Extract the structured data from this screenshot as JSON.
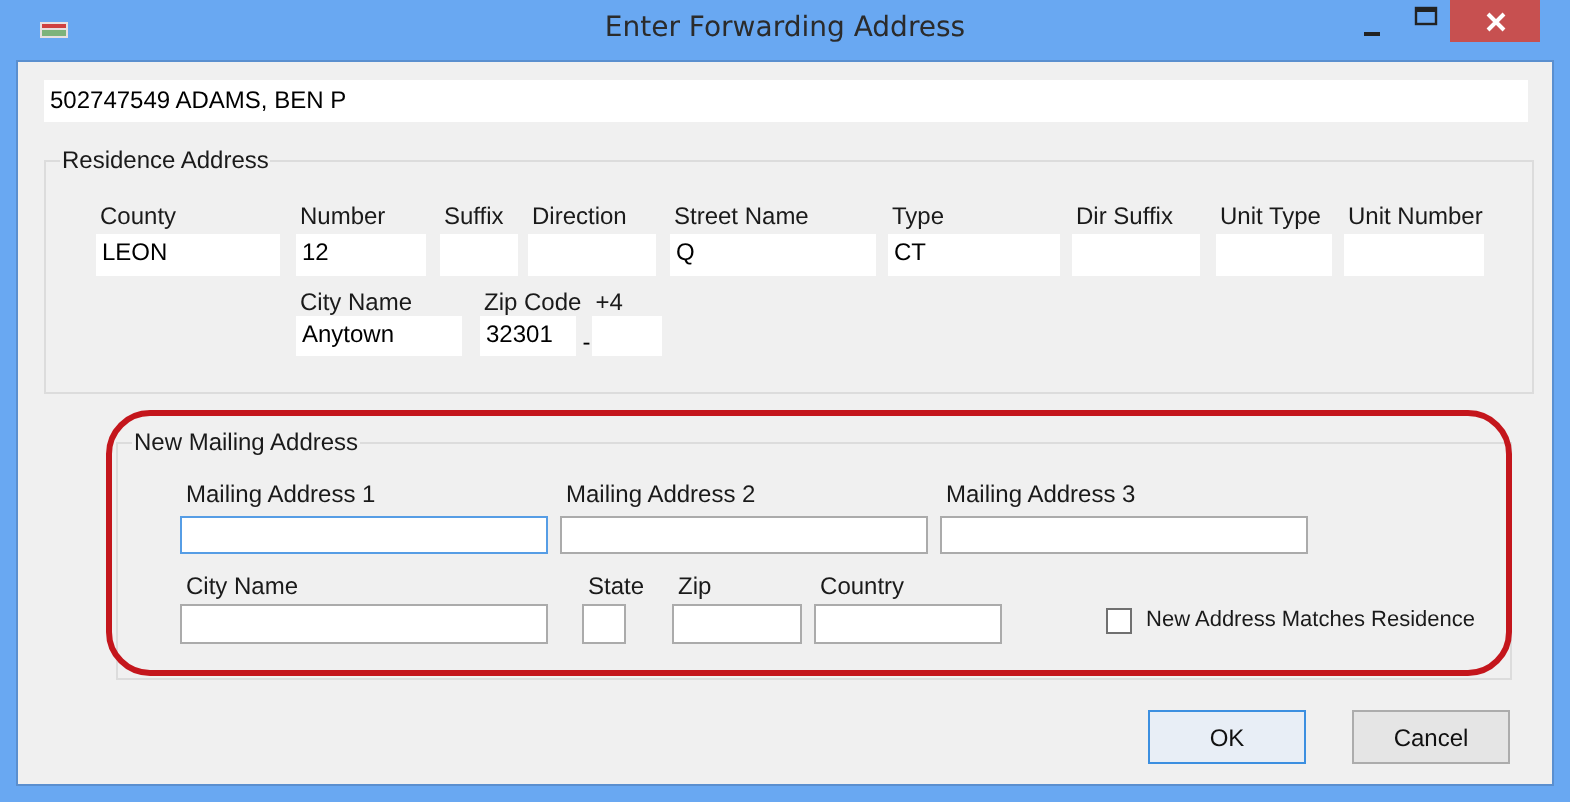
{
  "window": {
    "title": "Enter Forwarding Address"
  },
  "voter": {
    "value": "502747549 ADAMS, BEN P"
  },
  "residence": {
    "title": "Residence Address",
    "row_1": [
      {
        "label": "County",
        "value": "LEON"
      },
      {
        "label": "Number",
        "value": "12"
      },
      {
        "label": "Suffix"
      },
      {
        "label": "Direction"
      },
      {
        "label": "Street Name",
        "value": "Q"
      },
      {
        "label": "Type",
        "value": "CT"
      },
      {
        "label": "Dir Suffix"
      },
      {
        "label": "Unit Type"
      },
      {
        "label": "Unit Number"
      }
    ],
    "row_2": [
      {
        "label": "City Name",
        "value": "Anytown"
      },
      {
        "label": "Zip Code",
        "value": "32301"
      },
      {
        "label": "+4",
        "separator_before": "-"
      }
    ]
  },
  "mailing": {
    "title": "New Mailing Address",
    "row_1": [
      {
        "label": "Mailing Address 1",
        "focused": true
      },
      {
        "label": "Mailing Address 2",
        "focused": false
      },
      {
        "label": "Mailing Address 3",
        "focused": false
      }
    ],
    "row_2": [
      {
        "label": "City Name",
        "focused": false
      },
      {
        "label": "State",
        "focused": false
      },
      {
        "label": "Zip",
        "focused": false
      },
      {
        "label": "Country",
        "focused": false
      }
    ],
    "matches_residence": {
      "label": "New Address Matches Residence",
      "checked": false
    }
  },
  "buttons": [
    {
      "label": "OK",
      "focused": true
    },
    {
      "label": "Cancel",
      "focused": false
    }
  ]
}
